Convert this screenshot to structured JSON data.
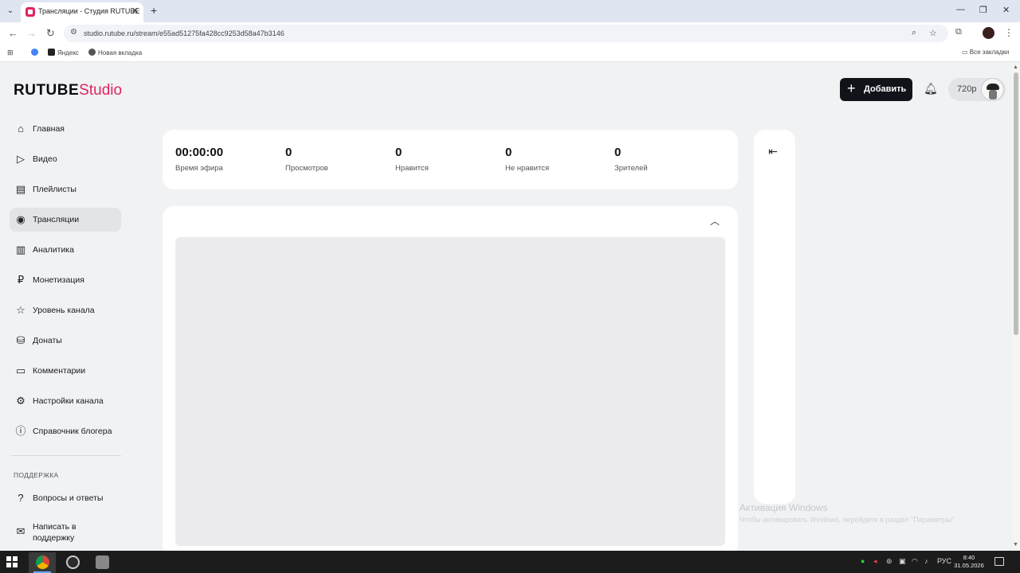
{
  "browser": {
    "tab_title": "Трансляции - Студия RUTUBE",
    "url": "studio.rutube.ru/stream/e55ad51275fa428cc9253d58a47b3146",
    "bookmarks": [
      "Яндекс",
      "Новая вкладка"
    ],
    "all_bookmarks": "Все закладки"
  },
  "brand": {
    "name": "RUTUBE",
    "suffix": "Studio",
    "accent_color": "#e0245e"
  },
  "sidebar": {
    "items": [
      {
        "label": "Главная",
        "icon": "home-icon"
      },
      {
        "label": "Видео",
        "icon": "video-icon"
      },
      {
        "label": "Плейлисты",
        "icon": "playlist-icon"
      },
      {
        "label": "Трансляции",
        "icon": "broadcast-icon",
        "active": true
      },
      {
        "label": "Аналитика",
        "icon": "analytics-icon"
      },
      {
        "label": "Монетизация",
        "icon": "ruble-icon"
      },
      {
        "label": "Уровень канала",
        "icon": "star-icon"
      },
      {
        "label": "Донаты",
        "icon": "donate-icon"
      },
      {
        "label": "Комментарии",
        "icon": "comments-icon"
      },
      {
        "label": "Настройки канала",
        "icon": "gear-icon"
      },
      {
        "label": "Справочник блогера",
        "icon": "info-icon"
      }
    ],
    "support_title": "ПОДДЕРЖКА",
    "support_items": [
      {
        "label": "Вопросы и ответы",
        "icon": "question-icon"
      },
      {
        "label": "Написать в поддержку",
        "icon": "mail-icon"
      }
    ]
  },
  "header": {
    "add_label": "Добавить",
    "resolution": "720p"
  },
  "stats": [
    {
      "value": "00:00:00",
      "caption": "Время эфира"
    },
    {
      "value": "0",
      "caption": "Просмотров"
    },
    {
      "value": "0",
      "caption": "Нравится"
    },
    {
      "value": "0",
      "caption": "Не нравится"
    },
    {
      "value": "0",
      "caption": "Зрителей"
    }
  ],
  "watermark": {
    "title": "Активация Windows",
    "subtitle": "Чтобы активировать Windows, перейдите в раздел \"Параметры\"."
  },
  "taskbar": {
    "lang": "РУС",
    "time": "8:40",
    "date": "31.05.2026"
  }
}
